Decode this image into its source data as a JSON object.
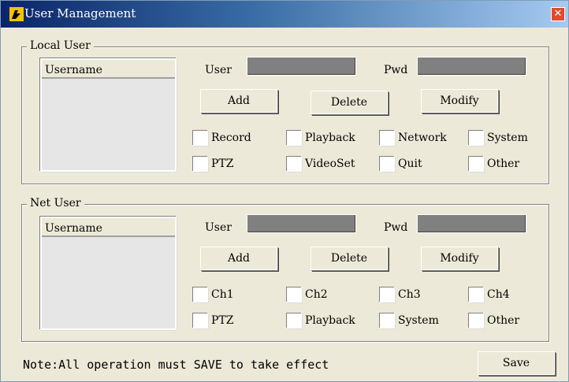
{
  "window": {
    "title": "User Management",
    "close_label": "✕"
  },
  "local_user": {
    "group_label": "Local User",
    "list_header": "Username",
    "user_label": "User",
    "pwd_label": "Pwd",
    "user_value": "",
    "pwd_value": "",
    "buttons": {
      "add": "Add",
      "delete": "Delete",
      "modify": "Modify"
    },
    "permissions": [
      "Record",
      "Playback",
      "Network",
      "System",
      "PTZ",
      "VideoSet",
      "Quit",
      "Other"
    ]
  },
  "net_user": {
    "group_label": "Net User",
    "list_header": "Username",
    "user_label": "User",
    "pwd_label": "Pwd",
    "user_value": "",
    "pwd_value": "",
    "buttons": {
      "add": "Add",
      "delete": "Delete",
      "modify": "Modify"
    },
    "permissions": [
      "Ch1",
      "Ch2",
      "Ch3",
      "Ch4",
      "PTZ",
      "Playback",
      "System",
      "Other"
    ]
  },
  "footer": {
    "note": "Note:All operation must SAVE to take effect",
    "save_label": "Save"
  },
  "colors": {
    "title_start": "#0a246a",
    "title_end": "#a6caf0",
    "dialog_bg": "#ece9d8",
    "input_bg": "#808080",
    "close_bg": "#e24a2b"
  }
}
